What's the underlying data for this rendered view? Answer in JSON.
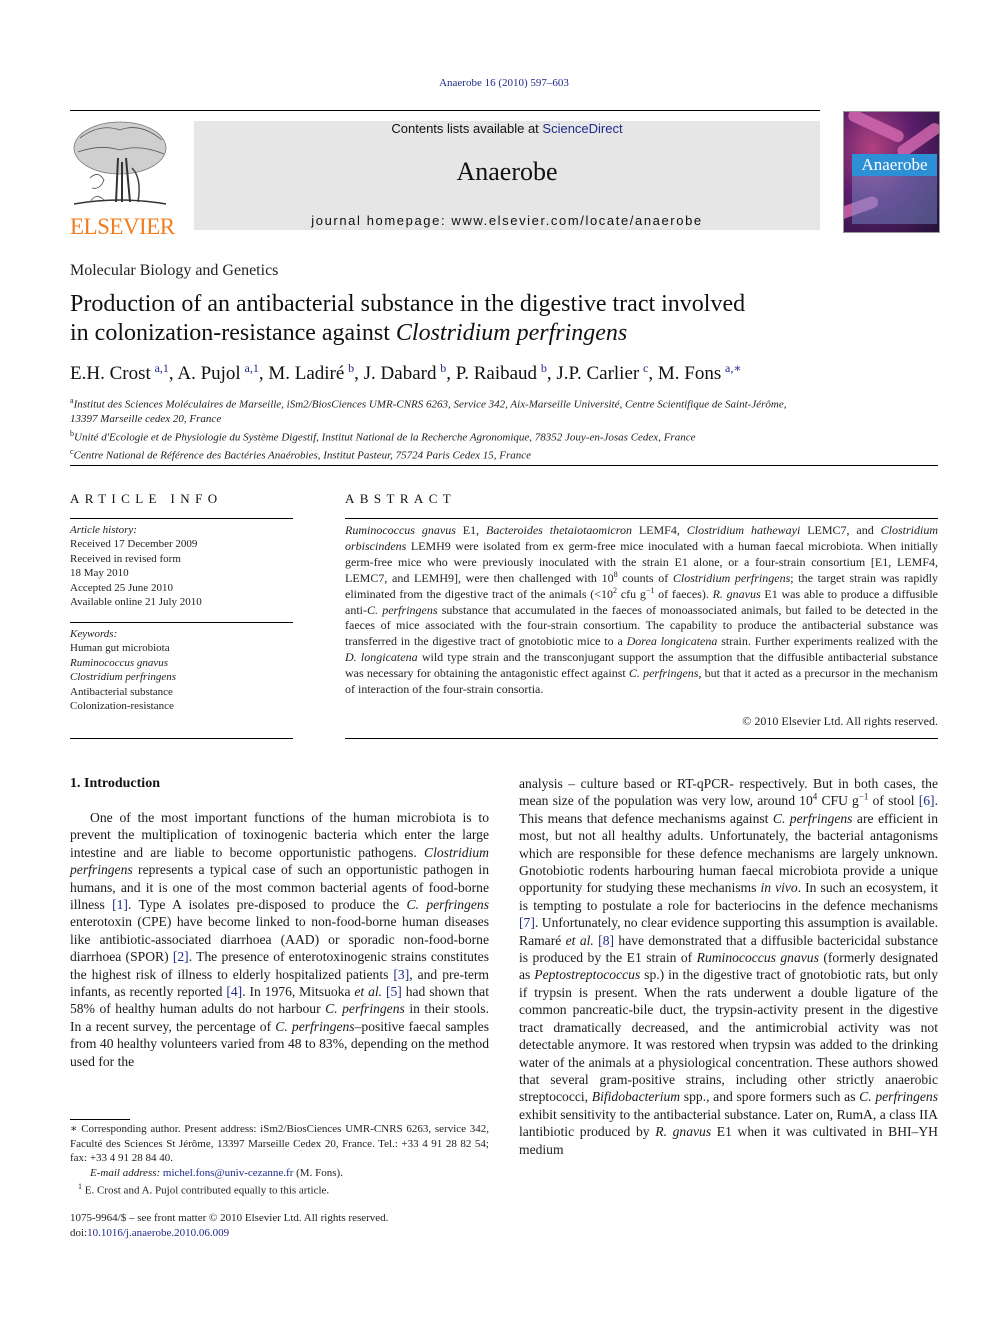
{
  "journal_ref": "Anaerobe 16 (2010) 597–603",
  "publisher": {
    "logo_word": "ELSEVIER",
    "contents_prefix": "Contents lists available at ",
    "contents_link": "ScienceDirect",
    "journal_title": "Anaerobe",
    "homepage": "journal homepage: www.elsevier.com/locate/anaerobe",
    "cover_title": "Anaerobe"
  },
  "section_label": "Molecular Biology and Genetics",
  "title": {
    "line1": "Production of an antibacterial substance in the digestive tract involved",
    "line2_prefix": "in colonization-resistance against ",
    "line2_italic": "Clostridium perfringens"
  },
  "authors": [
    {
      "name": "E.H. Crost",
      "sup": "a,1"
    },
    {
      "name": "A. Pujol",
      "sup": "a,1"
    },
    {
      "name": "M. Ladiré",
      "sup": "b"
    },
    {
      "name": "J. Dabard",
      "sup": "b"
    },
    {
      "name": "P. Raibaud",
      "sup": "b"
    },
    {
      "name": "J.P. Carlier",
      "sup": "c"
    },
    {
      "name": "M. Fons",
      "sup": "a,∗"
    }
  ],
  "affiliations": [
    {
      "mark": "a",
      "text": "Institut des Sciences Moléculaires de Marseille, iSm2/BiosCiences UMR-CNRS 6263, Service 342, Aix-Marseille Université, Centre Scientifique de Saint-Jérôme,",
      "text2": "13397 Marseille cedex 20, France"
    },
    {
      "mark": "b",
      "text": "Unité d'Ecologie et de Physiologie du Système Digestif, Institut National de la Recherche Agronomique, 78352 Jouy-en-Josas Cedex, France"
    },
    {
      "mark": "c",
      "text": "Centre National de Référence des Bactéries Anaérobies, Institut Pasteur, 75724 Paris Cedex 15, France"
    }
  ],
  "article_info": {
    "heading": "ARTICLE INFO",
    "history_label": "Article history:",
    "history": [
      "Received 17 December 2009",
      "Received in revised form",
      "18 May 2010",
      "Accepted 25 June 2010",
      "Available online 21 July 2010"
    ],
    "keywords_label": "Keywords:",
    "keywords": [
      {
        "text": "Human gut microbiota",
        "italic": false
      },
      {
        "text": "Ruminococcus gnavus",
        "italic": true
      },
      {
        "text": "Clostridium perfringens",
        "italic": true
      },
      {
        "text": "Antibacterial substance",
        "italic": false
      },
      {
        "text": "Colonization-resistance",
        "italic": false
      }
    ]
  },
  "abstract": {
    "heading": "ABSTRACT",
    "segments": [
      {
        "i": true,
        "t": "Ruminococcus gnavus"
      },
      {
        "t": " E1, "
      },
      {
        "i": true,
        "t": "Bacteroides thetaiotaomicron"
      },
      {
        "t": " LEMF4, "
      },
      {
        "i": true,
        "t": "Clostridium hathewayi"
      },
      {
        "t": " LEMC7, and "
      },
      {
        "i": true,
        "t": "Clostridium orbiscindens"
      },
      {
        "t": " LEMH9 were isolated from ex germ-free mice inoculated with a human faecal microbiota. When initially germ-free mice who were previously inoculated with the strain E1 alone, or a four-strain consortium [E1, LEMF4, LEMC7, and LEMH9], were then challenged with 10"
      },
      {
        "sup": true,
        "t": "8"
      },
      {
        "t": " counts of "
      },
      {
        "i": true,
        "t": "Clostridium perfringens"
      },
      {
        "t": "; the target strain was rapidly eliminated from the digestive tract of the animals (<10"
      },
      {
        "sup": true,
        "t": "2"
      },
      {
        "t": " cfu g"
      },
      {
        "sup": true,
        "t": "−1"
      },
      {
        "t": " of faeces). "
      },
      {
        "i": true,
        "t": "R. gnavus"
      },
      {
        "t": " E1 was able to produce a diffusible anti-"
      },
      {
        "i": true,
        "t": "C. perfringens"
      },
      {
        "t": " substance that accumulated in the faeces of monoassociated animals, but failed to be detected in the faeces of mice associated with the four-strain consortium. The capability to produce the antibacterial substance was transferred in the digestive tract of gnotobiotic mice to a "
      },
      {
        "i": true,
        "t": "Dorea longicatena"
      },
      {
        "t": " strain. Further experiments realized with the "
      },
      {
        "i": true,
        "t": "D. longicatena"
      },
      {
        "t": " wild type strain and the transconjugant support the assumption that the diffusible antibacterial substance was necessary for obtaining the antagonistic effect against "
      },
      {
        "i": true,
        "t": "C. perfringens"
      },
      {
        "t": ", but that it acted as a precursor in the mechanism of interaction of the four-strain consortia."
      }
    ],
    "copyright": "© 2010 Elsevier Ltd. All rights reserved."
  },
  "introduction": {
    "heading": "1.  Introduction",
    "left_segments": [
      {
        "t": "One of the most important functions of the human microbiota is to prevent the multiplication of toxinogenic bacteria which enter the large intestine and are liable to become opportunistic pathogens. "
      },
      {
        "i": true,
        "t": "Clostridium perfringens"
      },
      {
        "t": " represents a typical case of such an opportunistic pathogen in humans, and it is one of the most common bacterial agents of food-borne illness "
      },
      {
        "ref": true,
        "t": "[1]"
      },
      {
        "t": ". Type A isolates pre-disposed to produce the "
      },
      {
        "i": true,
        "t": "C. perfringens"
      },
      {
        "t": " enterotoxin (CPE) have become linked to non-food-borne human diseases like antibiotic-associated diarrhoea (AAD) or sporadic non-food-borne diarrhoea (SPOR) "
      },
      {
        "ref": true,
        "t": "[2]"
      },
      {
        "t": ". The presence of enterotoxinogenic strains constitutes the highest risk of illness to elderly hospitalized patients "
      },
      {
        "ref": true,
        "t": "[3]"
      },
      {
        "t": ", and pre-term infants, as recently reported "
      },
      {
        "ref": true,
        "t": "[4]"
      },
      {
        "t": ". In 1976, Mitsuoka "
      },
      {
        "i": true,
        "t": "et al."
      },
      {
        "t": " "
      },
      {
        "ref": true,
        "t": "[5]"
      },
      {
        "t": " had shown that 58% of healthy human adults do not harbour "
      },
      {
        "i": true,
        "t": "C. perfringens"
      },
      {
        "t": " in their stools. In a recent survey, the percentage of "
      },
      {
        "i": true,
        "t": "C. perfringens"
      },
      {
        "t": "–positive faecal samples from 40 healthy volunteers varied from 48 to 83%, depending on the method used for the"
      }
    ],
    "right_segments": [
      {
        "t": "analysis – culture based or RT-qPCR- respectively. But in both cases, the mean size of the population was very low, around 10"
      },
      {
        "sup": true,
        "t": "4"
      },
      {
        "t": " CFU g"
      },
      {
        "sup": true,
        "t": "−1"
      },
      {
        "t": " of stool "
      },
      {
        "ref": true,
        "t": "[6]"
      },
      {
        "t": ". This means that defence mechanisms against "
      },
      {
        "i": true,
        "t": "C. perfringens"
      },
      {
        "t": " are efficient in most, but not all healthy adults. Unfortunately, the bacterial antagonisms which are responsible for these defence mechanisms are largely unknown. Gnotobiotic rodents harbouring human faecal microbiota provide a unique opportunity for studying these mechanisms "
      },
      {
        "i": true,
        "t": "in vivo"
      },
      {
        "t": ". In such an ecosystem, it is tempting to postulate a role for bacteriocins in the defence mechanisms "
      },
      {
        "ref": true,
        "t": "[7]"
      },
      {
        "t": ". Unfortunately, no clear evidence supporting this assumption is available. Ramaré "
      },
      {
        "i": true,
        "t": "et al."
      },
      {
        "t": " "
      },
      {
        "ref": true,
        "t": "[8]"
      },
      {
        "t": " have demonstrated that a diffusible bactericidal substance is produced by the E1 strain of "
      },
      {
        "i": true,
        "t": "Ruminococcus gnavus"
      },
      {
        "t": " (formerly designated as "
      },
      {
        "i": true,
        "t": "Peptostreptococcus"
      },
      {
        "t": " sp.) in the digestive tract of gnotobiotic rats, but only if trypsin is present. When the rats underwent a double ligature of the common pancreatic-bile duct, the trypsin-activity present in the digestive tract dramatically decreased, and the antimicrobial activity was not detectable anymore. It was restored when trypsin was added to the drinking water of the animals at a physiological concentration. These authors showed that several gram-positive strains, including other strictly anaerobic streptococci, "
      },
      {
        "i": true,
        "t": "Bifidobacterium"
      },
      {
        "t": " spp., and spore formers such as "
      },
      {
        "i": true,
        "t": "C. perfringens"
      },
      {
        "t": " exhibit sensitivity to the antibacterial substance. Later on, RumA, a class IIA lantibiotic produced by "
      },
      {
        "i": true,
        "t": "R. gnavus"
      },
      {
        "t": " E1 when it was cultivated in BHI–YH medium"
      }
    ]
  },
  "footnotes": {
    "corresponding": "∗ Corresponding author. Present address: iSm2/BiosCiences UMR-CNRS 6263, service 342, Faculté des Sciences St Jérôme, 13397 Marseille Cedex 20, France. Tel.: +33 4 91 28 82 54; fax: +33 4 91 28 84 40.",
    "email_label": "E-mail address: ",
    "email": "michel.fons@univ-cezanne.fr",
    "email_suffix": " (M. Fons).",
    "equal_mark": "1",
    "equal": " E. Crost and A. Pujol contributed equally to this article."
  },
  "frontmatter": {
    "issn": "1075-9964/$ – see front matter © 2010 Elsevier Ltd. All rights reserved.",
    "doi_label": "doi:",
    "doi": "10.1016/j.anaerobe.2010.06.009"
  }
}
